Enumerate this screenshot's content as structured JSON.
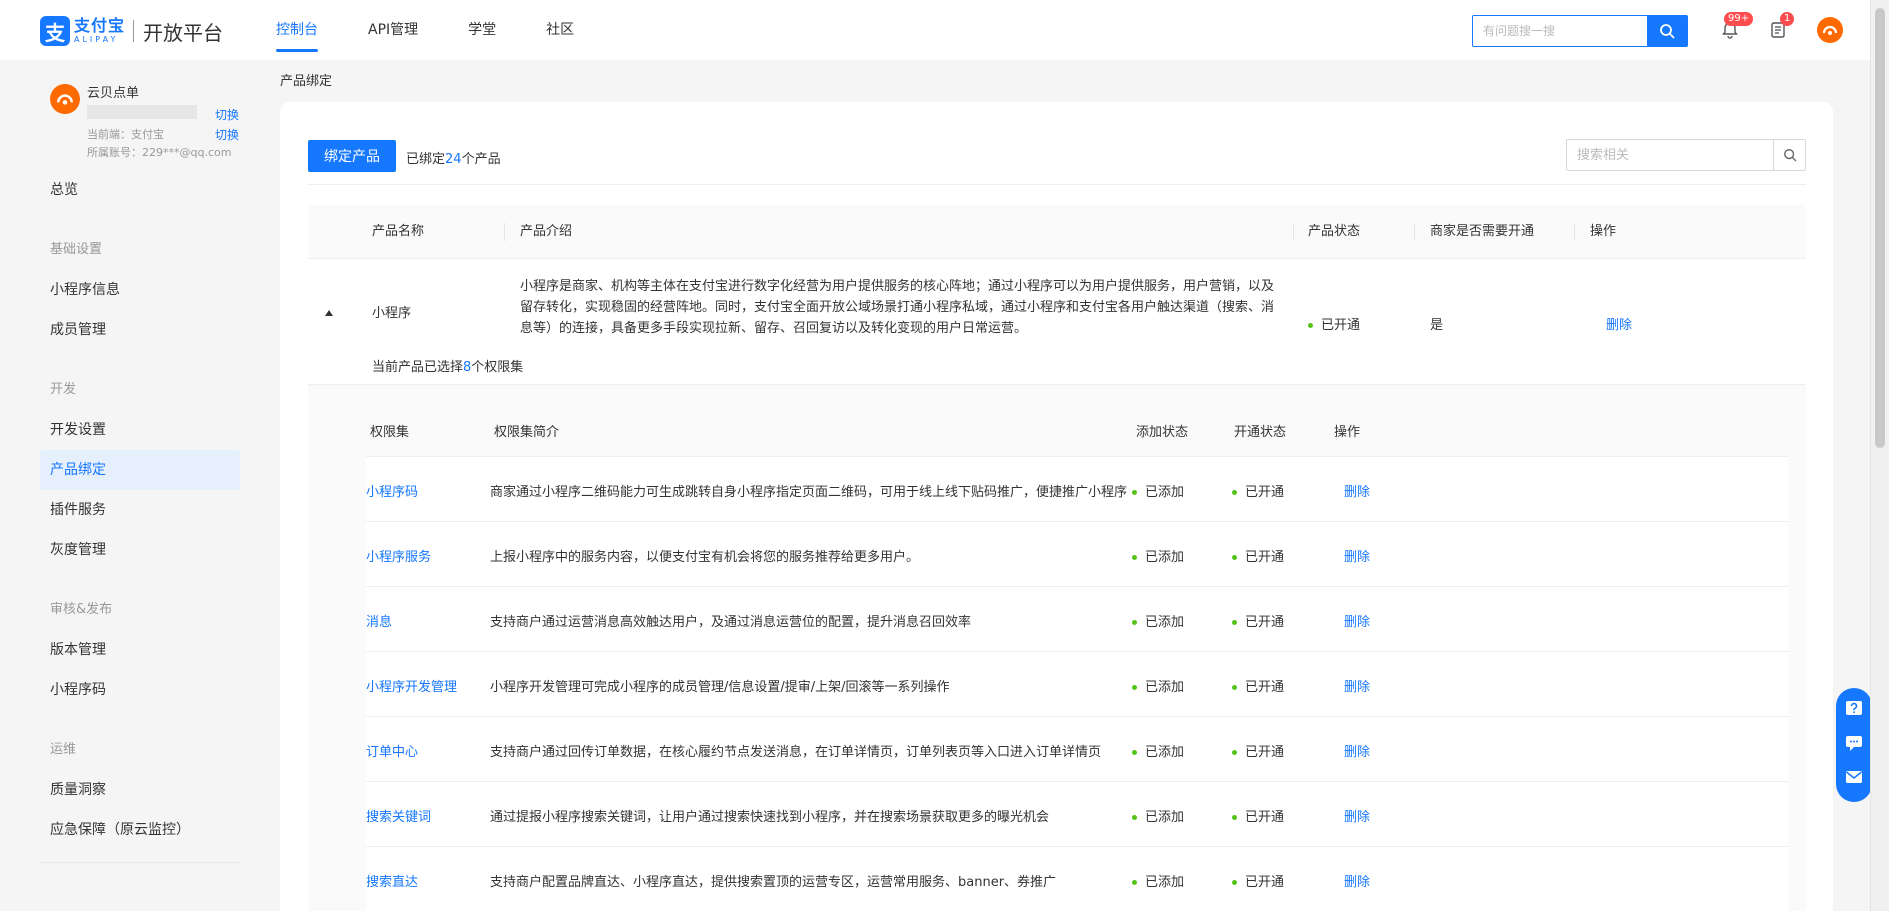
{
  "header": {
    "logo_cn": "支付宝",
    "logo_en": "ALIPAY",
    "platform": "开放平台",
    "nav": [
      "控制台",
      "API管理",
      "学堂",
      "社区"
    ],
    "search_placeholder": "有问题搜一搜",
    "notification_badge": "99+",
    "task_badge": "1"
  },
  "account": {
    "name": "云贝点单",
    "switch_label": "切换",
    "current_end": "当前端：支付宝",
    "account_line": "所属账号：229***@qq.com"
  },
  "sidebar": {
    "overview": "总览",
    "groups": [
      {
        "title": "基础设置",
        "items": [
          "小程序信息",
          "成员管理"
        ]
      },
      {
        "title": "开发",
        "items": [
          "开发设置",
          "产品绑定",
          "插件服务",
          "灰度管理"
        ]
      },
      {
        "title": "审核&发布",
        "items": [
          "版本管理",
          "小程序码"
        ]
      },
      {
        "title": "运维",
        "items": [
          "质量洞察",
          "应急保障（原云监控）"
        ]
      }
    ],
    "active_item": "产品绑定"
  },
  "main": {
    "breadcrumb": "产品绑定",
    "bind_button": "绑定产品",
    "bound_prefix": "已绑定",
    "bound_count": "24",
    "bound_suffix": "个产品",
    "search_placeholder": "搜索相关",
    "table_headers": [
      "产品名称",
      "产品介绍",
      "产品状态",
      "商家是否需要开通",
      "操作"
    ],
    "product": {
      "name": "小程序",
      "description": "小程序是商家、机构等主体在支付宝进行数字化经营为用户提供服务的核心阵地；通过小程序可以为用户提供服务，用户营销，以及留存转化，实现稳固的经营阵地。同时，支付宝全面开放公域场景打通小程序私域，通过小程序和支付宝各用户触达渠道（搜索、消息等）的连接，具备更多手段实现拉新、留存、召回复访以及转化变现的用户日常运营。",
      "status": "已开通",
      "merchant_need": "是",
      "action": "删除",
      "selected_prefix": "当前产品已选择",
      "selected_count": "8",
      "selected_suffix": "个权限集"
    },
    "permission_headers": [
      "权限集",
      "权限集简介",
      "添加状态",
      "开通状态",
      "操作"
    ],
    "permissions": [
      {
        "name": "小程序码",
        "desc": "商家通过小程序二维码能力可生成跳转自身小程序指定页面二维码，可用于线上线下贴码推广，便捷推广小程序",
        "add_status": "已添加",
        "open_status": "已开通",
        "action": "删除"
      },
      {
        "name": "小程序服务",
        "desc": "上报小程序中的服务内容，以便支付宝有机会将您的服务推荐给更多用户。",
        "add_status": "已添加",
        "open_status": "已开通",
        "action": "删除"
      },
      {
        "name": "消息",
        "desc": "支持商户通过运营消息高效触达用户，及通过消息运营位的配置，提升消息召回效率",
        "add_status": "已添加",
        "open_status": "已开通",
        "action": "删除"
      },
      {
        "name": "小程序开发管理",
        "desc": "小程序开发管理可完成小程序的成员管理/信息设置/提审/上架/回滚等一系列操作",
        "add_status": "已添加",
        "open_status": "已开通",
        "action": "删除"
      },
      {
        "name": "订单中心",
        "desc": "支持商户通过回传订单数据，在核心履约节点发送消息，在订单详情页，订单列表页等入口进入订单详情页",
        "add_status": "已添加",
        "open_status": "已开通",
        "action": "删除"
      },
      {
        "name": "搜索关键词",
        "desc": "通过提报小程序搜索关键词，让用户通过搜索快速找到小程序，并在搜索场景获取更多的曝光机会",
        "add_status": "已添加",
        "open_status": "已开通",
        "action": "删除"
      },
      {
        "name": "搜索直达",
        "desc": "支持商户配置品牌直达、小程序直达，提供搜索置顶的运营专区，运营常用服务、banner、券推广",
        "add_status": "已添加",
        "open_status": "已开通",
        "action": "删除"
      }
    ]
  },
  "colors": {
    "primary": "#1677ff",
    "success": "#52c41a",
    "danger": "#ff4d4f",
    "avatar": "#ff6a00"
  }
}
